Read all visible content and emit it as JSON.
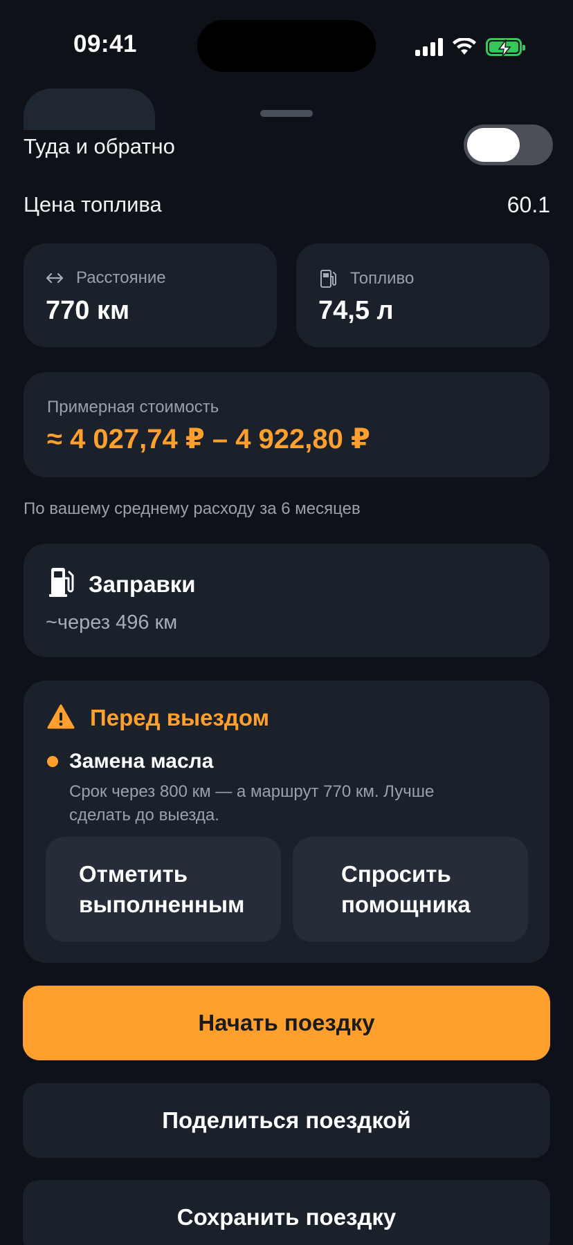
{
  "status_bar": {
    "time": "09:41"
  },
  "round_trip": {
    "label": "Туда и обратно",
    "enabled": false
  },
  "fuel_price": {
    "label": "Цена топлива",
    "value": "60.1"
  },
  "distance": {
    "label": "Расстояние",
    "value": "770 км",
    "icon": "arrows-horizontal-icon"
  },
  "fuel": {
    "label": "Топливо",
    "value": "74,5 л",
    "icon": "fuel-pump-icon"
  },
  "cost": {
    "label": "Примерная стоимость",
    "value": "≈ 4 027,74 ₽ – 4 922,80 ₽"
  },
  "avg_note": "По вашему среднему расходу за 6 месяцев",
  "stations": {
    "title": "Заправки",
    "subtitle": "~через 496 км",
    "icon": "fuel-pump-icon"
  },
  "warning": {
    "title": "Перед выездом",
    "icon": "warning-triangle-icon",
    "item_title": "Замена масла",
    "item_text": "Срок через 800 км — а маршрут 770 км. Лучше сделать до выезда.",
    "mark_done_label": "Отметить выполненным",
    "ask_assistant_label": "Спросить помощника"
  },
  "actions": {
    "start_label": "Начать поездку",
    "share_label": "Поделиться поездкой",
    "save_label": "Сохранить поездку"
  },
  "colors": {
    "accent": "#ff9f2d",
    "card": "#1b212b",
    "background": "#0e1218",
    "battery": "#34c759"
  }
}
